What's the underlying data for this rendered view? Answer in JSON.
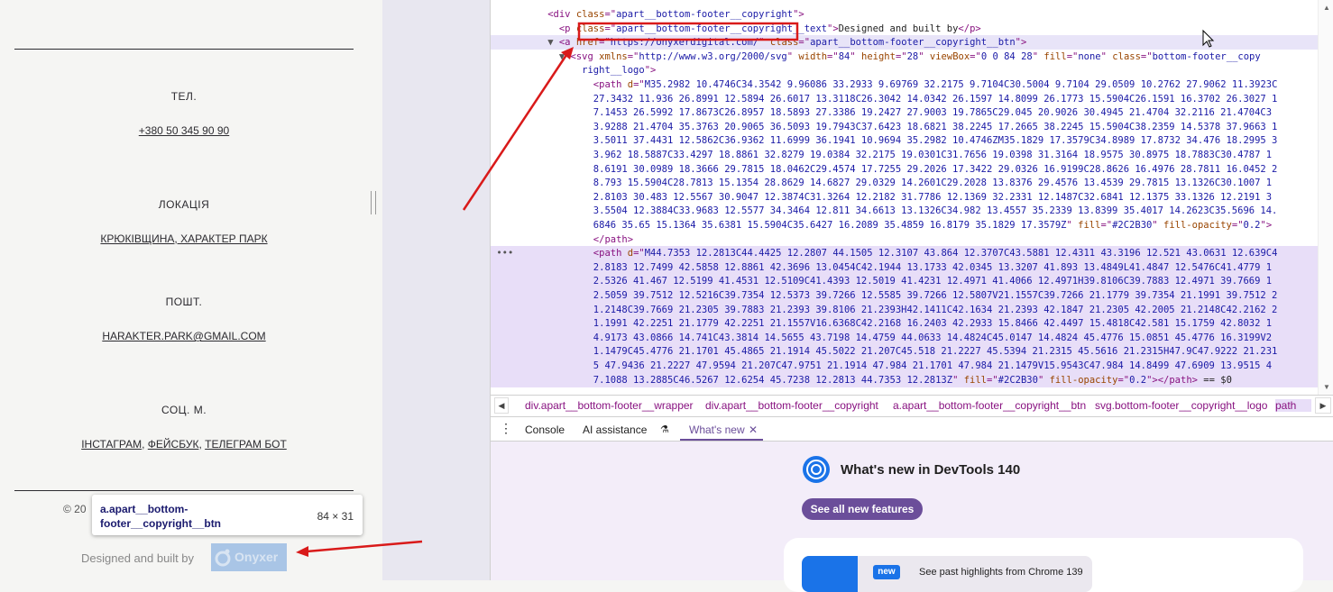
{
  "page": {
    "phone_label": "ТЕЛ.",
    "phone_value": "+380 50 345 90 90",
    "location_label": "ЛОКАЦІЯ",
    "location_value": "КРЮКІВЩИНА, ХАРАКТЕР ПАРК",
    "email_label": "ПОШТ.",
    "email_value": "HARAKTER.PARK@GMAIL.COM",
    "social_label": "СОЦ. М.",
    "social_links": [
      "ІНСТАГРАМ",
      "ФЕЙСБУК",
      "ТЕЛЕГРАМ БОТ"
    ],
    "social_sep": ",",
    "copyright_prefix": "© 20",
    "designed_text": "Designed and built by",
    "logo_text": "Onyxer"
  },
  "tooltip": {
    "selector": "a.apart__bottom-footer__copyright__btn",
    "size": "84 × 31"
  },
  "devtools": {
    "lines": [
      {
        "indent": "          ",
        "parts": [
          [
            "tag",
            "<div "
          ],
          [
            "an",
            "class"
          ],
          [
            "tag",
            "=\""
          ],
          [
            "av",
            "apart__bottom-footer__copyright"
          ],
          [
            "tag",
            "\">"
          ]
        ]
      },
      {
        "indent": "            ",
        "parts": [
          [
            "tag",
            "<p "
          ],
          [
            "an",
            "class"
          ],
          [
            "tag",
            "=\""
          ],
          [
            "av",
            "apart__bottom-footer__copyright__text"
          ],
          [
            "tag",
            "\">"
          ],
          [
            "txt",
            "Designed and built by"
          ],
          [
            "tag",
            "</p>"
          ]
        ]
      },
      {
        "indent": "          ▼ ",
        "parts": [
          [
            "tag",
            "<a "
          ],
          [
            "an",
            "href"
          ],
          [
            "tag",
            "=\""
          ],
          [
            "av",
            "https://onyxerdigital.com/"
          ],
          [
            "tag",
            "\" "
          ],
          [
            "an",
            "class"
          ],
          [
            "tag",
            "=\""
          ],
          [
            "av",
            "apart__bottom-footer__copyright__btn"
          ],
          [
            "tag",
            "\">"
          ]
        ]
      },
      {
        "indent": "            ▼ ",
        "parts": [
          [
            "tag",
            "<svg "
          ],
          [
            "an",
            "xmlns"
          ],
          [
            "tag",
            "=\""
          ],
          [
            "av",
            "http://www.w3.org/2000/svg"
          ],
          [
            "tag",
            "\" "
          ],
          [
            "an",
            "width"
          ],
          [
            "tag",
            "=\""
          ],
          [
            "av",
            "84"
          ],
          [
            "tag",
            "\" "
          ],
          [
            "an",
            "height"
          ],
          [
            "tag",
            "=\""
          ],
          [
            "av",
            "28"
          ],
          [
            "tag",
            "\" "
          ],
          [
            "an",
            "viewBox"
          ],
          [
            "tag",
            "=\""
          ],
          [
            "av",
            "0 0 84 28"
          ],
          [
            "tag",
            "\" "
          ],
          [
            "an",
            "fill"
          ],
          [
            "tag",
            "=\""
          ],
          [
            "av",
            "none"
          ],
          [
            "tag",
            "\" "
          ],
          [
            "an",
            "class"
          ],
          [
            "tag",
            "=\""
          ],
          [
            "av",
            "bottom-footer__copy"
          ]
        ]
      },
      {
        "indent": "                ",
        "parts": [
          [
            "av",
            "right__logo"
          ],
          [
            "tag",
            "\">"
          ]
        ]
      },
      {
        "indent": "                  ",
        "parts": [
          [
            "tag",
            "<path "
          ],
          [
            "an",
            "d"
          ],
          [
            "tag",
            "=\""
          ],
          [
            "av",
            "M35.2982 10.4746C34.3542 9.96086 33.2933 9.69769 32.2175 9.7104C30.5004 9.7104 29.0509 10.2762 27.9062 11.3923C"
          ]
        ]
      },
      {
        "indent": "                  ",
        "parts": [
          [
            "av",
            "27.3432 11.936 26.8991 12.5894 26.6017 13.3118C26.3042 14.0342 26.1597 14.8099 26.1773 15.5904C26.1591 16.3702 26.3027 1"
          ]
        ]
      },
      {
        "indent": "                  ",
        "parts": [
          [
            "av",
            "7.1453 26.5992 17.8673C26.8957 18.5893 27.3386 19.2427 27.9003 19.7865C29.045 20.9026 30.4945 21.4704 32.2116 21.4704C3"
          ]
        ]
      },
      {
        "indent": "                  ",
        "parts": [
          [
            "av",
            "3.9288 21.4704 35.3763 20.9065 36.5093 19.7943C37.6423 18.6821 38.2245 17.2665 38.2245 15.5904C38.2359 14.5378 37.9663 1"
          ]
        ]
      },
      {
        "indent": "                  ",
        "parts": [
          [
            "av",
            "3.5011 37.4431 12.5862C36.9362 11.6999 36.1941 10.9694 35.2982 10.4746ZM35.1829 17.3579C34.8989 17.8732 34.476 18.2995 3"
          ]
        ]
      },
      {
        "indent": "                  ",
        "parts": [
          [
            "av",
            "3.962 18.5887C33.4297 18.8861 32.8279 19.0384 32.2175 19.0301C31.7656 19.0398 31.3164 18.9575 30.8975 18.7883C30.4787 1"
          ]
        ]
      },
      {
        "indent": "                  ",
        "parts": [
          [
            "av",
            "8.6191 30.0989 18.3666 29.7815 18.0462C29.4574 17.7255 29.2026 17.3422 29.0326 16.9199C28.8626 16.4976 28.7811 16.0452 2"
          ]
        ]
      },
      {
        "indent": "                  ",
        "parts": [
          [
            "av",
            "8.793 15.5904C28.7813 15.1354 28.8629 14.6827 29.0329 14.2601C29.2028 13.8376 29.4576 13.4539 29.7815 13.1326C30.1007 1"
          ]
        ]
      },
      {
        "indent": "                  ",
        "parts": [
          [
            "av",
            "2.8103 30.483 12.5567 30.9047 12.3874C31.3264 12.2182 31.7786 12.1369 32.2331 12.1487C32.6841 12.1375 33.1326 12.2191 3"
          ]
        ]
      },
      {
        "indent": "                  ",
        "parts": [
          [
            "av",
            "3.5504 12.3884C33.9683 12.5577 34.3464 12.811 34.6613 13.1326C34.982 13.4557 35.2339 13.8399 35.4017 14.2623C35.5696 14."
          ]
        ]
      },
      {
        "indent": "                  ",
        "parts": [
          [
            "av",
            "6846 35.65 15.1364 35.6381 15.5904C35.6427 16.2089 35.4859 16.8179 35.1829 17.3579Z"
          ],
          [
            "tag",
            "\" "
          ],
          [
            "an",
            "fill"
          ],
          [
            "tag",
            "=\""
          ],
          [
            "av",
            "#2C2B30"
          ],
          [
            "tag",
            "\" "
          ],
          [
            "an",
            "fill-opacity"
          ],
          [
            "tag",
            "=\""
          ],
          [
            "av",
            "0.2"
          ],
          [
            "tag",
            "\">"
          ]
        ]
      },
      {
        "indent": "                  ",
        "parts": [
          [
            "tag",
            "</path>"
          ]
        ]
      },
      {
        "indent": " •••              ",
        "parts": [
          [
            "tag",
            "<path "
          ],
          [
            "an",
            "d"
          ],
          [
            "tag",
            "=\""
          ],
          [
            "av",
            "M44.7353 12.2813C44.4425 12.2807 44.1505 12.3107 43.864 12.3707C43.5881 12.4311 43.3196 12.521 43.0631 12.639C4"
          ]
        ]
      },
      {
        "indent": "                  ",
        "parts": [
          [
            "av",
            "2.8183 12.7499 42.5858 12.8861 42.3696 13.0454C42.1944 13.1733 42.0345 13.3207 41.893 13.4849L41.4847 12.5476C41.4779 1"
          ]
        ]
      },
      {
        "indent": "                  ",
        "parts": [
          [
            "av",
            "2.5326 41.467 12.5199 41.4531 12.5109C41.4393 12.5019 41.4231 12.4971 41.4066 12.4971H39.8106C39.7883 12.4971 39.7669 1"
          ]
        ]
      },
      {
        "indent": "                  ",
        "parts": [
          [
            "av",
            "2.5059 39.7512 12.5216C39.7354 12.5373 39.7266 12.5585 39.7266 12.5807V21.1557C39.7266 21.1779 39.7354 21.1991 39.7512 2"
          ]
        ]
      },
      {
        "indent": "                  ",
        "parts": [
          [
            "av",
            "1.2148C39.7669 21.2305 39.7883 21.2393 39.8106 21.2393H42.1411C42.1634 21.2393 42.1847 21.2305 42.2005 21.2148C42.2162 2"
          ]
        ]
      },
      {
        "indent": "                  ",
        "parts": [
          [
            "av",
            "1.1991 42.2251 21.1779 42.2251 21.1557V16.6368C42.2168 16.2403 42.2933 15.8466 42.4497 15.4818C42.581 15.1759 42.8032 1"
          ]
        ]
      },
      {
        "indent": "                  ",
        "parts": [
          [
            "av",
            "4.9173 43.0866 14.741C43.3814 14.5655 43.7198 14.4759 44.0633 14.4824C45.0147 14.4824 45.4776 15.0851 45.4776 16.3199V2"
          ]
        ]
      },
      {
        "indent": "                  ",
        "parts": [
          [
            "av",
            "1.1479C45.4776 21.1701 45.4865 21.1914 45.5022 21.207C45.518 21.2227 45.5394 21.2315 45.5616 21.2315H47.9C47.9222 21.231"
          ]
        ]
      },
      {
        "indent": "                  ",
        "parts": [
          [
            "av",
            "5 47.9436 21.2227 47.9594 21.207C47.9751 21.1914 47.984 21.1701 47.984 21.1479V15.9543C47.984 14.8499 47.6909 13.9515 4"
          ]
        ]
      },
      {
        "indent": "                  ",
        "parts": [
          [
            "av",
            "7.1088 13.2885C46.5267 12.6254 45.7238 12.2813 44.7353 12.2813Z"
          ],
          [
            "tag",
            "\" "
          ],
          [
            "an",
            "fill"
          ],
          [
            "tag",
            "=\""
          ],
          [
            "av",
            "#2C2B30"
          ],
          [
            "tag",
            "\" "
          ],
          [
            "an",
            "fill-opacity"
          ],
          [
            "tag",
            "=\""
          ],
          [
            "av",
            "0.2"
          ],
          [
            "tag",
            "\"></path>"
          ],
          [
            "txt",
            " == $0"
          ]
        ]
      }
    ],
    "breadcrumbs": [
      "div.apart__bottom-footer__wrapper",
      "div.apart__bottom-footer__copyright",
      "a.apart__bottom-footer__copyright__btn",
      "svg.bottom-footer__copyright__logo",
      "path"
    ],
    "tabs": [
      "Console",
      "AI assistance",
      "What's new"
    ],
    "whatsnew_title": "What's new in DevTools 140",
    "see_all": "See all new features",
    "new_badge": "new",
    "highlight_text": "See past highlights from Chrome 139"
  },
  "colors": {
    "accent": "#6b4e9a",
    "annotation": "#d91a1a",
    "text": "#2c2b30"
  }
}
